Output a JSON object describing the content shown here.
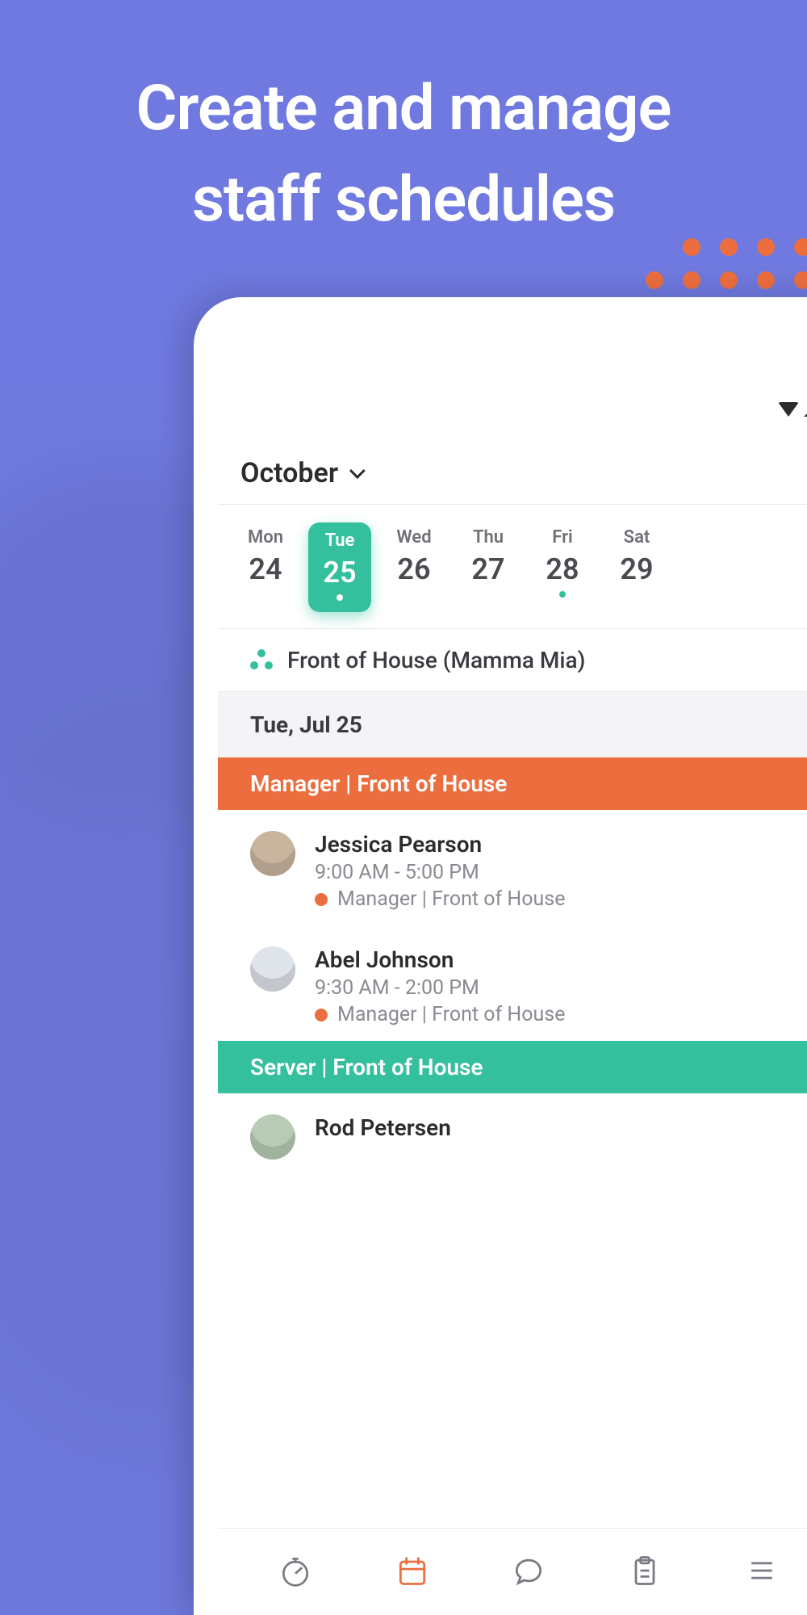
{
  "hero": {
    "line1": "Create and manage",
    "line2": "staff schedules"
  },
  "month": "October",
  "days": [
    {
      "name": "Mon",
      "num": "24",
      "selected": false,
      "mark": false
    },
    {
      "name": "Tue",
      "num": "25",
      "selected": true,
      "mark": true
    },
    {
      "name": "Wed",
      "num": "26",
      "selected": false,
      "mark": false
    },
    {
      "name": "Thu",
      "num": "27",
      "selected": false,
      "mark": false
    },
    {
      "name": "Fri",
      "num": "28",
      "selected": false,
      "mark": true
    },
    {
      "name": "Sat",
      "num": "29",
      "selected": false,
      "mark": false
    }
  ],
  "section_title": "Front of House (Mamma Mia)",
  "date_band": "Tue, Jul 25",
  "roles": {
    "manager": "Manager | Front of House",
    "server": "Server | Front of House"
  },
  "staff": {
    "0": {
      "name": "Jessica Pearson",
      "time": "9:00 AM - 5:00 PM",
      "role": "Manager | Front of House"
    },
    "1": {
      "name": "Abel Johnson",
      "time": "9:30 AM - 2:00 PM",
      "role": "Manager | Front of House"
    },
    "2": {
      "name": "Rod Petersen",
      "time": "",
      "role": ""
    }
  },
  "colors": {
    "accent_orange": "#ec6e3f",
    "accent_teal": "#34bf9d",
    "brand_purple": "#7a85e0"
  },
  "tabs": [
    "stopwatch",
    "calendar",
    "chat",
    "clipboard",
    "menu"
  ]
}
